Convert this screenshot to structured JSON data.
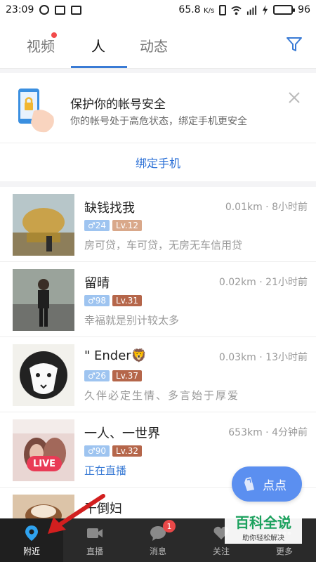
{
  "status_bar": {
    "time": "23:09",
    "speed": "65.8",
    "speed_unit": "K/s",
    "battery": "96"
  },
  "tabs": [
    {
      "label": "视频",
      "has_dot": true
    },
    {
      "label": "人",
      "active": true
    },
    {
      "label": "动态"
    }
  ],
  "security_card": {
    "title": "保护你的帐号安全",
    "description": "你的帐号处于高危状态，绑定手机更安全",
    "action": "绑定手机"
  },
  "users": [
    {
      "name": "缺钱找我",
      "distance_time": "0.01km · 8小时前",
      "gender_age": "♂24",
      "level": "Lv.12",
      "level_color": "#d9a88a",
      "signature": "房可贷，车可贷，无房无车信用贷"
    },
    {
      "name": "留晴",
      "distance_time": "0.02km · 21小时前",
      "gender_age": "♂98",
      "level": "Lv.31",
      "level_color": "#b5664a",
      "signature": "幸福就是别计较太多"
    },
    {
      "name": "\" Ender🦁",
      "distance_time": "0.03km · 13小时前",
      "gender_age": "♂26",
      "level": "Lv.37",
      "level_color": "#b5664a",
      "signature": "久伴必定生情、多言始于厚爱"
    },
    {
      "name": "一人、一世界",
      "distance_time": "653km · 4分钟前",
      "gender_age": "♂90",
      "level": "Lv.32",
      "level_color": "#b5664a",
      "signature": "正在直播",
      "live_label": "LIVE"
    },
    {
      "name": "干倒妇",
      "distance_time": "",
      "gender_age": "",
      "level": "",
      "level_color": "#b5664a",
      "signature": ""
    }
  ],
  "fab": {
    "label": "点点"
  },
  "watermark": {
    "title": "百科全说",
    "subtitle": "助你轻松解决"
  },
  "bottom_nav": [
    {
      "label": "附近",
      "icon": "location-pin-icon",
      "active": true
    },
    {
      "label": "直播",
      "icon": "video-camera-icon"
    },
    {
      "label": "消息",
      "icon": "chat-bubble-icon",
      "badge": "1"
    },
    {
      "label": "关注",
      "icon": "heart-icon"
    },
    {
      "label": "更多",
      "icon": "more-icon"
    }
  ],
  "colors": {
    "accent_blue": "#3a7bd5",
    "bottom_nav_bg": "#2a2a2a",
    "live_red": "#e93b56",
    "fab_blue": "#5b8ff0"
  }
}
